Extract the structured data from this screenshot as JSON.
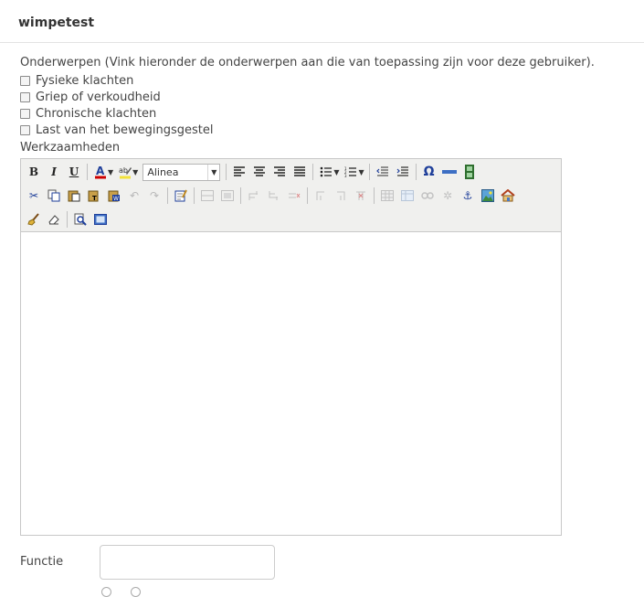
{
  "page": {
    "title": "wimpetest"
  },
  "subjects": {
    "intro": "Onderwerpen (Vink hieronder de onderwerpen aan die van toepassing zijn voor deze gebruiker).",
    "items": [
      {
        "label": "Fysieke klachten",
        "checked": false
      },
      {
        "label": "Griep of verkoudheid",
        "checked": false
      },
      {
        "label": "Chronische klachten",
        "checked": false
      },
      {
        "label": "Last van het bewegingsgestel",
        "checked": false
      }
    ]
  },
  "work": {
    "label": "Werkzaamheden",
    "format_select": "Alinea",
    "editor_content": ""
  },
  "function": {
    "label": "Functie",
    "value": ""
  }
}
